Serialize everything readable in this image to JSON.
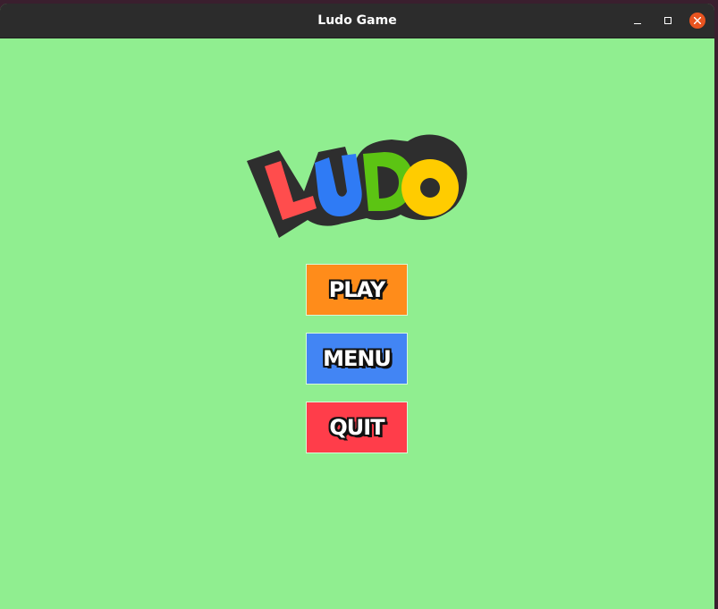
{
  "window": {
    "title": "Ludo Game",
    "background_color": "#90ee90"
  },
  "logo": {
    "text": "LUDO",
    "letter_colors": [
      "#ff4d4d",
      "#2f7bf5",
      "#5cc413",
      "#ffcc00"
    ],
    "outline_color": "#2e2e2e"
  },
  "buttons": [
    {
      "label": "PLAY",
      "color": "#ff8c1a"
    },
    {
      "label": "MENU",
      "color": "#4285f4"
    },
    {
      "label": "QUIT",
      "color": "#ff3d4a"
    }
  ],
  "icons": {
    "minimize": "minimize-icon",
    "maximize": "maximize-icon",
    "close": "close-icon"
  }
}
